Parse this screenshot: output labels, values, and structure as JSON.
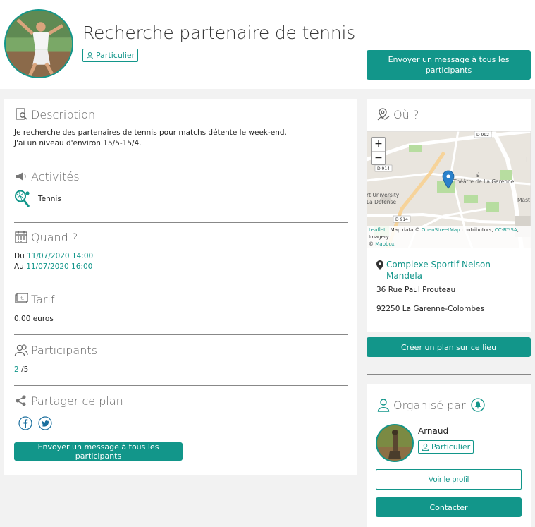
{
  "header": {
    "title": "Recherche partenaire de tennis",
    "badge": "Particulier",
    "message_all_button": "Envoyer un message à tous les participants"
  },
  "description": {
    "title": "Description",
    "line1": "Je recherche des partenaires de tennis pour matchs détente le week-end.",
    "line2": "J'ai un niveau d'environ 15/5-15/4."
  },
  "activities": {
    "title": "Activités",
    "items": [
      {
        "label": "Tennis",
        "icon": "tennis-racket-icon"
      }
    ]
  },
  "when": {
    "title": "Quand ?",
    "from_prefix": "Du",
    "from_value": "11/07/2020 14:00",
    "to_prefix": "Au",
    "to_value": "11/07/2020 16:00"
  },
  "price": {
    "title": "Tarif",
    "value": "0.00 euros"
  },
  "participants": {
    "title": "Participants",
    "count": "2",
    "max": "/5"
  },
  "share": {
    "title": "Partager ce plan",
    "networks": [
      "facebook-icon",
      "twitter-icon"
    ],
    "message_all_button": "Envoyer un message à tous les participants"
  },
  "where": {
    "title": "Où ?",
    "map": {
      "zoom_in": "+",
      "zoom_out": "−",
      "road_labels": [
        "D 992",
        "D 914",
        "D 914"
      ],
      "place_labels": [
        "Théâtre de La Garenne",
        "rt University",
        "La Défense",
        "L",
        "Mast",
        "É"
      ],
      "attribution": {
        "leaflet": "Leaflet",
        "map_data": " | Map data © ",
        "osm": "OpenStreetMap",
        "contributors": " contributors, ",
        "license": "CC-BY-SA",
        "imagery": ", Imagery",
        "copyright": "© ",
        "mapbox": "Mapbox"
      }
    },
    "venue_name": "Complexe Sportif Nelson Mandela",
    "street": "36 Rue Paul Prouteau",
    "city": "92250 La Garenne-Colombes",
    "create_plan_button": "Créer un plan sur ce lieu"
  },
  "organizer": {
    "title": "Organisé par",
    "name": "Arnaud",
    "badge": "Particulier",
    "profile_button": "Voir le profil",
    "contact_button": "Contacter"
  },
  "colors": {
    "accent": "#12968a",
    "background": "#f2f2f2",
    "text": "#222222"
  }
}
